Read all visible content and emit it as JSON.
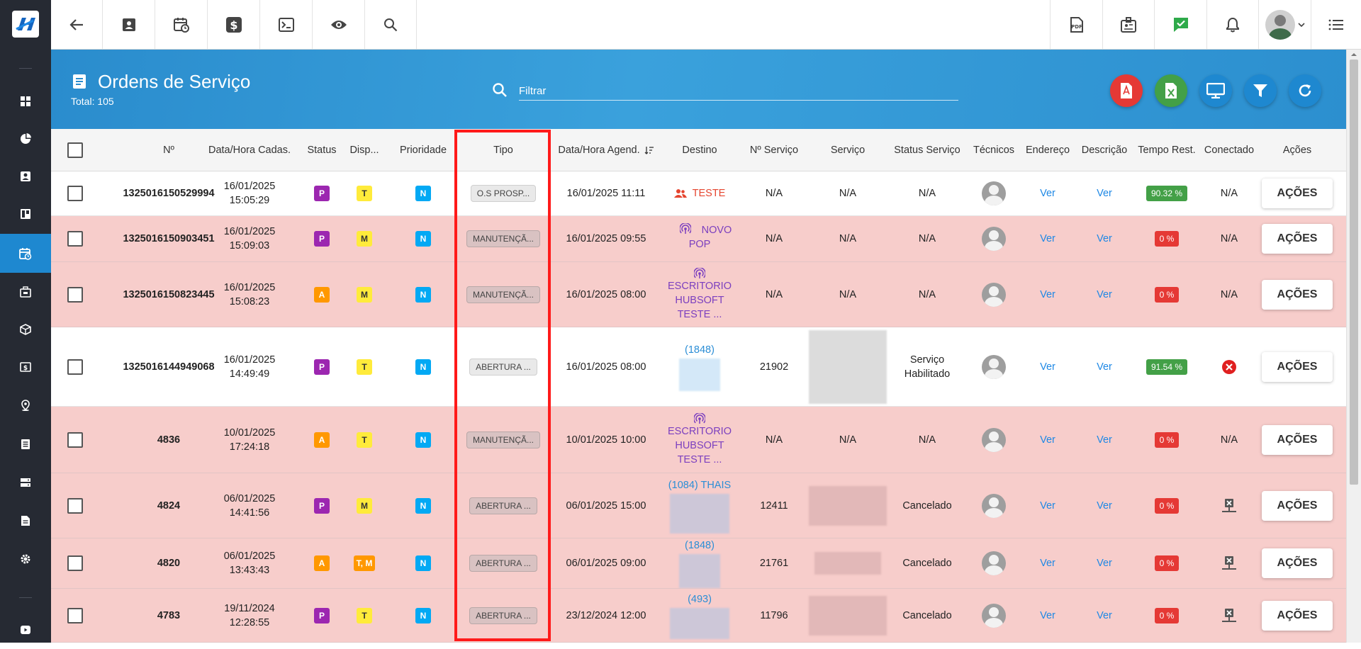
{
  "header": {
    "title": "Ordens de Serviço",
    "total": "Total: 105",
    "search_placeholder": "Filtrar"
  },
  "topbar": {
    "left_icons": [
      "back-arrow-icon",
      "contact-card-icon",
      "calendar-clock-icon",
      "dollar-icon",
      "terminal-icon",
      "eye-icon",
      "search-icon"
    ],
    "right_icons": [
      "pdf-file-icon",
      "badge-id-icon",
      "check-message-icon",
      "bell-icon",
      "user-avatar-icon",
      "list-menu-icon"
    ]
  },
  "sidebar": {
    "items": [
      "dashboard-icon",
      "pie-chart-icon",
      "contact-icon",
      "board-icon",
      "calendar-icon",
      "briefcase-icon",
      "box-icon",
      "dollar-box-icon",
      "map-pin-icon",
      "document-icon",
      "server-icon",
      "file-icon",
      "settings-icon",
      "video-icon"
    ],
    "active_index": 4
  },
  "actions": [
    "pdf-export-button",
    "excel-export-button",
    "monitor-button",
    "filter-button",
    "refresh-button"
  ],
  "columns": [
    "Nº",
    "Data/Hora Cadas.",
    "Status",
    "Disp...",
    "Prioridade",
    "Tipo",
    "Data/Hora Agend.",
    "Destino",
    "Nº Serviço",
    "Serviço",
    "Status Serviço",
    "Técnicos",
    "Endereço",
    "Descrição",
    "Tempo Rest.",
    "Conectado",
    "Ações"
  ],
  "rows": [
    {
      "num": "1325016150529994",
      "date1": "16/01/2025",
      "time1": "15:05:29",
      "status": "P",
      "disp": "T",
      "prio": "N",
      "tipo": "O.S PROSP...",
      "agend": "16/01/2025 11:11",
      "destino": [
        "TESTE"
      ],
      "destino_type": "person",
      "nservico": "N/A",
      "servico": "N/A",
      "status_servico": [
        "N/A"
      ],
      "endereco": "Ver",
      "descricao": "Ver",
      "tempo": "90.32 %",
      "tempo_color": "green",
      "conectado": "N/A",
      "acoes": "AÇÕES",
      "bg": "white"
    },
    {
      "num": "1325016150903451",
      "date1": "16/01/2025",
      "time1": "15:09:03",
      "status": "P",
      "disp": "M",
      "prio": "N",
      "tipo": "MANUTENÇÃ...",
      "agend": "16/01/2025 09:55",
      "destino": [
        "NOVO",
        "POP"
      ],
      "destino_type": "pop",
      "nservico": "N/A",
      "servico": "N/A",
      "status_servico": [
        "N/A"
      ],
      "endereco": "Ver",
      "descricao": "Ver",
      "tempo": "0 %",
      "tempo_color": "red",
      "conectado": "N/A",
      "acoes": "AÇÕES",
      "bg": "pink"
    },
    {
      "num": "1325016150823445",
      "date1": "16/01/2025",
      "time1": "15:08:23",
      "status": "A",
      "disp": "M",
      "prio": "N",
      "tipo": "MANUTENÇÃ...",
      "agend": "16/01/2025 08:00",
      "destino": [
        "ESCRITORIO",
        "HUBSOFT",
        "TESTE ..."
      ],
      "destino_type": "pop",
      "nservico": "N/A",
      "servico": "N/A",
      "status_servico": [
        "N/A"
      ],
      "endereco": "Ver",
      "descricao": "Ver",
      "tempo": "0 %",
      "tempo_color": "red",
      "conectado": "N/A",
      "acoes": "AÇÕES",
      "bg": "pink"
    },
    {
      "num": "1325016144949068",
      "date1": "16/01/2025",
      "time1": "14:49:49",
      "status": "P",
      "disp": "T",
      "prio": "N",
      "tipo": "ABERTURA ...",
      "agend": "16/01/2025 08:00",
      "destino": [
        "(1848)"
      ],
      "destino_type": "client",
      "nservico": "21902",
      "servico": "",
      "status_servico": [
        "Serviço",
        "Habilitado"
      ],
      "endereco": "Ver",
      "descricao": "Ver",
      "tempo": "91.54 %",
      "tempo_color": "green",
      "conectado": "error",
      "acoes": "AÇÕES",
      "bg": "white"
    },
    {
      "num": "4836",
      "date1": "10/01/2025",
      "time1": "17:24:18",
      "status": "A",
      "disp": "T",
      "prio": "N",
      "tipo": "MANUTENÇÃ...",
      "agend": "10/01/2025 10:00",
      "destino": [
        "ESCRITORIO",
        "HUBSOFT",
        "TESTE ..."
      ],
      "destino_type": "pop",
      "nservico": "N/A",
      "servico": "N/A",
      "status_servico": [
        "N/A"
      ],
      "endereco": "Ver",
      "descricao": "Ver",
      "tempo": "0 %",
      "tempo_color": "red",
      "conectado": "N/A",
      "acoes": "AÇÕES",
      "bg": "pink"
    },
    {
      "num": "4824",
      "date1": "06/01/2025",
      "time1": "14:41:56",
      "status": "P",
      "disp": "M",
      "prio": "N",
      "tipo": "ABERTURA ...",
      "agend": "06/01/2025 15:00",
      "destino": [
        "(1084) THAIS"
      ],
      "destino_type": "client",
      "nservico": "12411",
      "servico": "",
      "status_servico": [
        "Cancelado"
      ],
      "endereco": "Ver",
      "descricao": "Ver",
      "tempo": "0 %",
      "tempo_color": "red",
      "conectado": "network-x",
      "acoes": "AÇÕES",
      "bg": "pink"
    },
    {
      "num": "4820",
      "date1": "06/01/2025",
      "time1": "13:43:43",
      "status": "A",
      "disp": "T, M",
      "prio": "N",
      "tipo": "ABERTURA ...",
      "agend": "06/01/2025 09:00",
      "destino": [
        "(1848)"
      ],
      "destino_type": "client",
      "nservico": "21761",
      "servico": "",
      "status_servico": [
        "Cancelado"
      ],
      "endereco": "Ver",
      "descricao": "Ver",
      "tempo": "0 %",
      "tempo_color": "red",
      "conectado": "network-x",
      "acoes": "AÇÕES",
      "bg": "pink"
    },
    {
      "num": "4783",
      "date1": "19/11/2024",
      "time1": "12:28:55",
      "status": "P",
      "disp": "T",
      "prio": "N",
      "tipo": "ABERTURA ...",
      "agend": "23/12/2024 12:00",
      "destino": [
        "(493)"
      ],
      "destino_type": "client",
      "nservico": "11796",
      "servico": "",
      "status_servico": [
        "Cancelado"
      ],
      "endereco": "Ver",
      "descricao": "Ver",
      "tempo": "0 %",
      "tempo_color": "red",
      "conectado": "network-x",
      "acoes": "AÇÕES",
      "bg": "pink"
    }
  ]
}
